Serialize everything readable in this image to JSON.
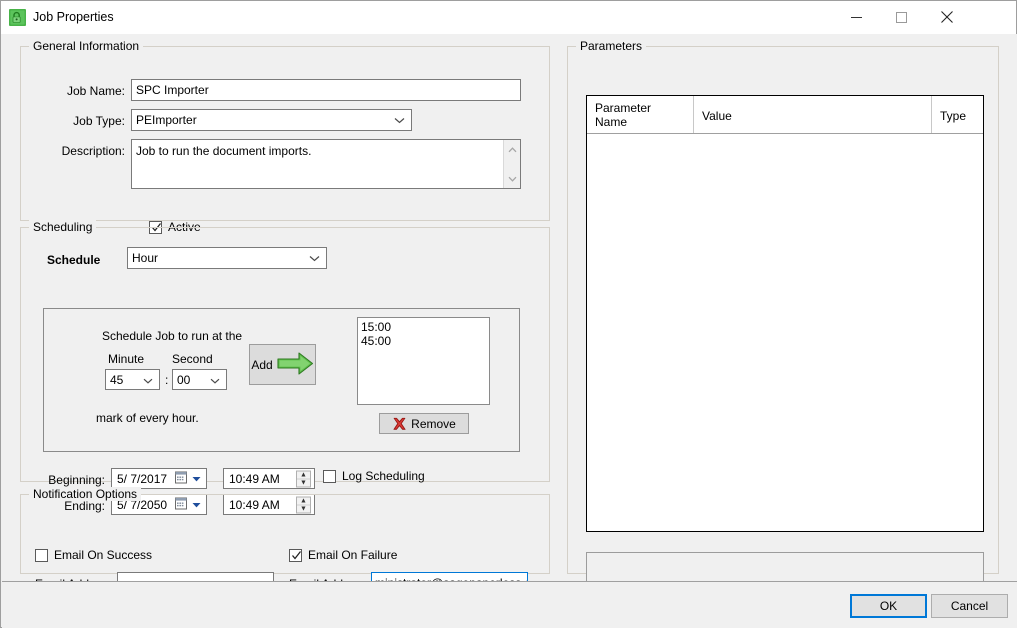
{
  "window": {
    "title": "Job Properties",
    "icon": "app-lock-icon",
    "controls": {
      "minimize": "minimize-icon",
      "maximize": "maximize-icon",
      "close": "close-icon"
    }
  },
  "general": {
    "legend": "General Information",
    "job_name_label": "Job Name:",
    "job_name_value": "SPC Importer",
    "job_type_label": "Job Type:",
    "job_type_value": "PEImporter",
    "description_label": "Description:",
    "description_value": "Job to run the document imports.",
    "active_label": "Active",
    "active_checked": true
  },
  "scheduling": {
    "legend": "Scheduling",
    "schedule_label": "Schedule",
    "schedule_value": "Hour",
    "run_at_text": "Schedule Job to run at the",
    "minute_label": "Minute",
    "minute_value": "45",
    "separator": ":",
    "second_label": "Second",
    "second_value": "00",
    "mark_text": "mark of every hour.",
    "add_button": "Add",
    "add_icon": "green-arrow-right-icon",
    "remove_button": "Remove",
    "remove_icon": "red-x-icon",
    "times": [
      "15:00",
      "45:00"
    ],
    "beginning_label": "Beginning:",
    "beginning_date": "5/  7/2017",
    "beginning_time": "10:49 AM",
    "ending_label": "Ending:",
    "ending_date": "5/  7/2050",
    "ending_time": "10:49 AM",
    "log_scheduling_label": "Log Scheduling",
    "log_scheduling_checked": false
  },
  "notification": {
    "legend": "Notification Options",
    "success_label": "Email On Success",
    "success_checked": false,
    "success_email_label": "Email Address:",
    "success_email_value": "",
    "failure_label": "Email On Failure",
    "failure_checked": true,
    "failure_email_label": "Email Address:",
    "failure_email_value": "ministrator@sagepaperless.com"
  },
  "parameters": {
    "legend": "Parameters",
    "columns": [
      "Parameter\nName",
      "Value",
      "Type"
    ],
    "col_name_line1": "Parameter",
    "col_name_line2": "Name",
    "col_value": "Value",
    "col_type": "Type",
    "rows": [],
    "status_text": ""
  },
  "footer": {
    "ok_label": "OK",
    "cancel_label": "Cancel"
  },
  "colors": {
    "accent": "#0078d7",
    "window_bg": "#f0f0f0",
    "field_bg": "#ffffff",
    "green": "#3aa03a",
    "red": "#cc2222"
  }
}
